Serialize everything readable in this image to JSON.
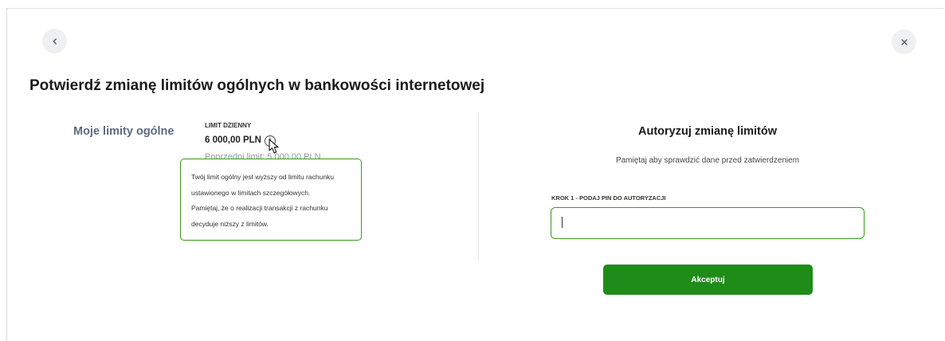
{
  "header": {
    "title": "Potwierdź zmianę limitów ogólnych w bankowości internetowej",
    "back_icon": "chevron-left-icon",
    "close_icon": "close-icon"
  },
  "limits": {
    "section_label": "Moje limity ogólne",
    "daily_label": "LIMIT DZIENNY",
    "daily_value": "6 000,00 PLN",
    "previous_limit": "Poprzedni limit: 5 000,00 PLN",
    "tooltip": {
      "lines": [
        "Twój limit ogólny jest wyższy od limitu rachunku",
        "ustawionego w limitach szczegółowych.",
        "Pamiętaj, że o realizacji transakcji z rachunku",
        "decyduje niższy z limitów."
      ]
    }
  },
  "auth": {
    "title": "Autoryzuj zmianę limitów",
    "subtitle": "Pamiętaj aby sprawdzić dane przed zatwierdzeniem",
    "step_label": "KROK 1 - PODAJ PIN DO AUTORYZACJI",
    "pin_value": "",
    "accept_label": "Akceptuj"
  },
  "colors": {
    "accent": "#1f8c1a",
    "border_green": "#3a9a1c",
    "section_label": "#5b6b80",
    "muted": "#8a9aac"
  }
}
